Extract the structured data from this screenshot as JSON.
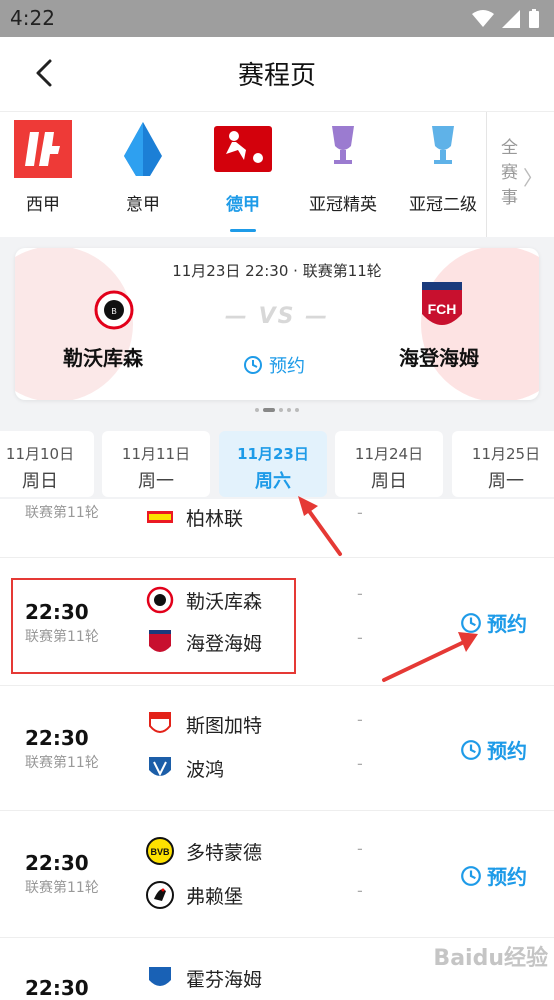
{
  "status": {
    "time": "4:22"
  },
  "header": {
    "title": "赛程页"
  },
  "leagues": [
    {
      "name": "西甲",
      "active": false
    },
    {
      "name": "意甲",
      "active": false
    },
    {
      "name": "德甲",
      "active": true
    },
    {
      "name": "亚冠精英",
      "active": false
    },
    {
      "name": "亚冠二级",
      "active": false
    }
  ],
  "all_label": "全赛事",
  "banner": {
    "datetime": "11月23日 22:30 · 联赛第11轮",
    "vs": "VS",
    "home": "勒沃库森",
    "away": "海登海姆",
    "book_label": "预约"
  },
  "dates": [
    {
      "date": "11月10日",
      "weekday": "周日"
    },
    {
      "date": "11月11日",
      "weekday": "周一"
    },
    {
      "date": "11月23日",
      "weekday": "周六",
      "active": true
    },
    {
      "date": "11月24日",
      "weekday": "周日"
    },
    {
      "date": "11月25日",
      "weekday": "周一"
    }
  ],
  "matches": [
    {
      "round": "联赛第11轮",
      "away": "柏林联"
    },
    {
      "time": "22:30",
      "round": "联赛第11轮",
      "home": "勒沃库森",
      "away": "海登海姆",
      "book": "预约"
    },
    {
      "time": "22:30",
      "round": "联赛第11轮",
      "home": "斯图加特",
      "away": "波鸿",
      "book": "预约"
    },
    {
      "time": "22:30",
      "round": "联赛第11轮",
      "home": "多特蒙德",
      "away": "弗赖堡",
      "book": "预约"
    },
    {
      "time": "22:30",
      "home": "霍芬海姆"
    }
  ],
  "dash": "-",
  "watermark": "Baidu经验",
  "colors": {
    "accent": "#1e9be8",
    "highlight": "#e53935"
  }
}
